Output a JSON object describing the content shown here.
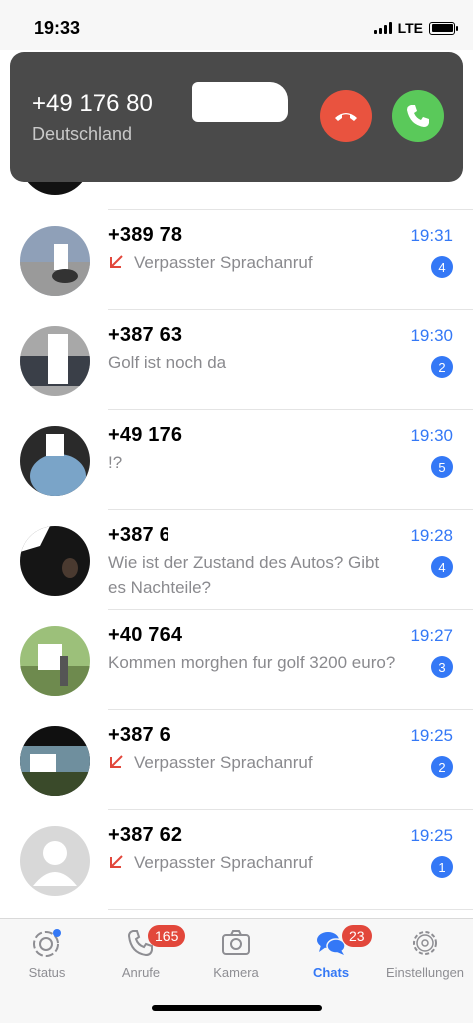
{
  "status_bar": {
    "time": "19:33",
    "network": "LTE"
  },
  "incoming_call": {
    "number": "+49 176 80",
    "country": "Deutschland"
  },
  "chats": [
    {
      "name": "+389 78",
      "time": "19:31",
      "message": "Verpasster Sprachanruf",
      "missed_call": true,
      "unread": "4"
    },
    {
      "name": "+387 63",
      "time": "19:30",
      "message": "Golf ist noch da",
      "missed_call": false,
      "unread": "2"
    },
    {
      "name": "+49 176",
      "time": "19:30",
      "message": "!?",
      "missed_call": false,
      "unread": "5"
    },
    {
      "name": "+387 6",
      "time": "19:28",
      "message": "Wie ist der Zustand des Autos? Gibt es Nachteile?",
      "missed_call": false,
      "unread": "4"
    },
    {
      "name": "+40 764",
      "time": "19:27",
      "message": "Kommen morghen fur golf 3200 euro?",
      "missed_call": false,
      "unread": "3"
    },
    {
      "name": "+387 6",
      "time": "19:25",
      "message": "Verpasster Sprachanruf",
      "missed_call": true,
      "unread": "2"
    },
    {
      "name": "+387 62",
      "time": "19:25",
      "message": "Verpasster Sprachanruf",
      "missed_call": true,
      "unread": "1"
    }
  ],
  "tabs": {
    "status": {
      "label": "Status",
      "icon": "status-icon"
    },
    "calls": {
      "label": "Anrufe",
      "badge": "165",
      "icon": "phone-icon"
    },
    "camera": {
      "label": "Kamera",
      "icon": "camera-icon"
    },
    "chats": {
      "label": "Chats",
      "badge": "23",
      "icon": "chat-bubbles-icon"
    },
    "settings": {
      "label": "Einstellungen",
      "icon": "gear-icon"
    }
  },
  "colors": {
    "accent": "#3478f6",
    "decline": "#e9533f",
    "accept": "#5ac95a",
    "badge_red": "#e2473b"
  }
}
